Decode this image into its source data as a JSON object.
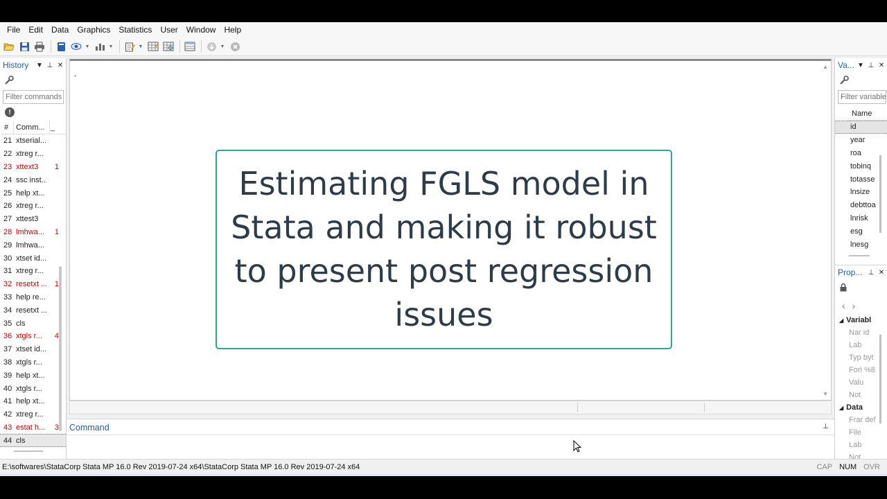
{
  "menu": [
    "File",
    "Edit",
    "Data",
    "Graphics",
    "Statistics",
    "User",
    "Window",
    "Help"
  ],
  "toolbar": {
    "icons": [
      "open-icon",
      "save-icon",
      "print-icon",
      "log-icon",
      "viewer-icon",
      "graph-icon",
      "do-file-editor-icon",
      "data-editor-icon",
      "data-browser-icon",
      "variables-manager-icon",
      "more-icon",
      "break-icon"
    ]
  },
  "history": {
    "title": "History",
    "filter_placeholder": "Filter commands",
    "col_num": "#",
    "col_cmd": "Comm...",
    "col_rc": "_",
    "rows": [
      {
        "n": "21",
        "cmd": "xtserial...",
        "rc": "",
        "err": false
      },
      {
        "n": "22",
        "cmd": "xtreg r...",
        "rc": "",
        "err": false
      },
      {
        "n": "23",
        "cmd": "xttext3",
        "rc": "1",
        "err": true
      },
      {
        "n": "24",
        "cmd": "ssc inst...",
        "rc": "",
        "err": false
      },
      {
        "n": "25",
        "cmd": "help xt...",
        "rc": "",
        "err": false
      },
      {
        "n": "26",
        "cmd": "xtreg r...",
        "rc": "",
        "err": false
      },
      {
        "n": "27",
        "cmd": "xttest3",
        "rc": "",
        "err": false
      },
      {
        "n": "28",
        "cmd": "lmhwa...",
        "rc": "1",
        "err": true
      },
      {
        "n": "29",
        "cmd": "lmhwa...",
        "rc": "",
        "err": false
      },
      {
        "n": "30",
        "cmd": "xtset id...",
        "rc": "",
        "err": false
      },
      {
        "n": "31",
        "cmd": "xtreg r...",
        "rc": "",
        "err": false
      },
      {
        "n": "32",
        "cmd": "resetxt ...",
        "rc": "1",
        "err": true
      },
      {
        "n": "33",
        "cmd": "help re...",
        "rc": "",
        "err": false
      },
      {
        "n": "34",
        "cmd": "resetxt ...",
        "rc": "",
        "err": false
      },
      {
        "n": "35",
        "cmd": "cls",
        "rc": "",
        "err": false
      },
      {
        "n": "36",
        "cmd": "xtgls r...",
        "rc": "4",
        "err": true
      },
      {
        "n": "37",
        "cmd": "xtset id...",
        "rc": "",
        "err": false
      },
      {
        "n": "38",
        "cmd": "xtgls r...",
        "rc": "",
        "err": false
      },
      {
        "n": "39",
        "cmd": "help xt...",
        "rc": "",
        "err": false
      },
      {
        "n": "40",
        "cmd": "xtgls r...",
        "rc": "",
        "err": false
      },
      {
        "n": "41",
        "cmd": "help xt...",
        "rc": "",
        "err": false
      },
      {
        "n": "42",
        "cmd": "xtreg r...",
        "rc": "",
        "err": false
      },
      {
        "n": "43",
        "cmd": "estat h...",
        "rc": "3",
        "err": true
      },
      {
        "n": "44",
        "cmd": "cls",
        "rc": "",
        "err": false
      }
    ]
  },
  "results": {
    "prompt": "."
  },
  "overlay": {
    "text": "Estimating FGLS model in Stata and making it robust to present post regression issues"
  },
  "command": {
    "label": "Command",
    "value": ""
  },
  "variables": {
    "title": "Va...",
    "filter_placeholder": "Filter variables",
    "col_name": "Name",
    "rows": [
      "id",
      "year",
      "roa",
      "tobinq",
      "totasse",
      "lnsize",
      "debttoa",
      "lnrisk",
      "esg",
      "lnesg"
    ]
  },
  "properties": {
    "title": "Prop...",
    "variables_section": "Variabl",
    "variables_rows": [
      "Nar id",
      "Lab",
      "Typ byt",
      "Fori %8",
      "Valu",
      "Not"
    ],
    "data_section": "Data",
    "data_rows": [
      "Frar def",
      "File",
      "Lab",
      "Not"
    ]
  },
  "status": {
    "path": "E:\\softwares\\StataCorp Stata MP 16.0 Rev 2019-07-24 x64\\StataCorp Stata MP 16.0 Rev 2019-07-24 x64",
    "caps": "CAP",
    "num": "NUM",
    "ovr": "OVR"
  },
  "colors": {
    "accent": "#2aa693",
    "panel_title": "#1f5f9f",
    "error_text": "#c00000"
  }
}
